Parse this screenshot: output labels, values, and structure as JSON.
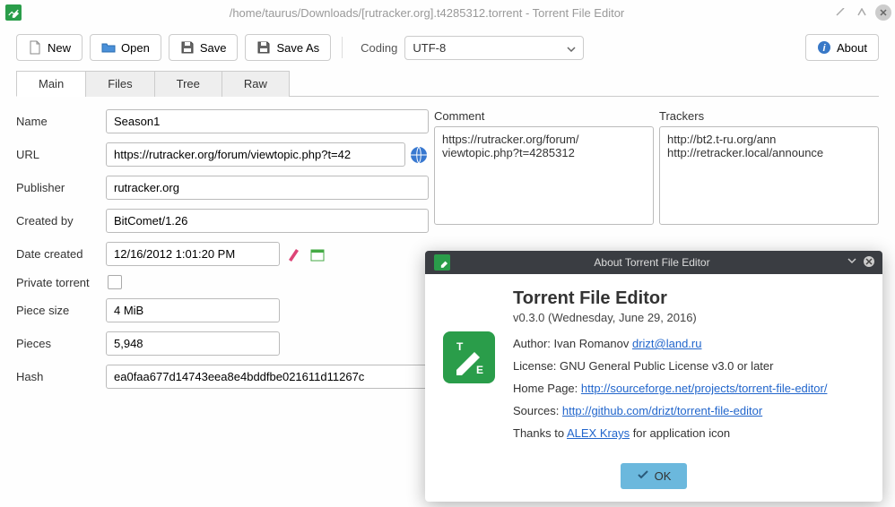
{
  "window": {
    "title": "/home/taurus/Downloads/[rutracker.org].t4285312.torrent - Torrent File Editor"
  },
  "toolbar": {
    "new": "New",
    "open": "Open",
    "save": "Save",
    "saveAs": "Save As",
    "codingLabel": "Coding",
    "codingValue": "UTF-8",
    "about": "About"
  },
  "tabs": {
    "main": "Main",
    "files": "Files",
    "tree": "Tree",
    "raw": "Raw"
  },
  "form": {
    "nameLabel": "Name",
    "name": "Season1",
    "urlLabel": "URL",
    "url": "https://rutracker.org/forum/viewtopic.php?t=42",
    "publisherLabel": "Publisher",
    "publisher": "rutracker.org",
    "createdByLabel": "Created by",
    "createdBy": "BitComet/1.26",
    "dateLabel": "Date created",
    "date": "12/16/2012 1:01:20 PM",
    "privateLabel": "Private torrent",
    "pieceSizeLabel": "Piece size",
    "pieceSize": "4 MiB",
    "piecesLabel": "Pieces",
    "pieces": "5,948",
    "hashLabel": "Hash",
    "hash": "ea0faa677d14743eea8e4bddfbe021611d11267c"
  },
  "comment": {
    "label": "Comment",
    "value": "https://rutracker.org/forum/\nviewtopic.php?t=4285312"
  },
  "trackers": {
    "label": "Trackers",
    "value": "http://bt2.t-ru.org/ann\nhttp://retracker.local/announce"
  },
  "about": {
    "title": "About Torrent File Editor",
    "name": "Torrent File Editor",
    "version": "v0.3.0 (Wednesday, June 29, 2016)",
    "authorLabel": "Author: Ivan Romanov ",
    "authorEmail": "drizt@land.ru",
    "license": "License: GNU General Public License v3.0 or later",
    "homepageLabel": "Home Page: ",
    "homepage": "http://sourceforge.net/projects/torrent-file-editor/",
    "sourcesLabel": "Sources: ",
    "sources": "http://github.com/drizt/torrent-file-editor",
    "thanksPrefix": "Thanks to ",
    "thanksLink": "ALEX Krays",
    "thanksSuffix": " for application icon",
    "ok": "OK"
  }
}
